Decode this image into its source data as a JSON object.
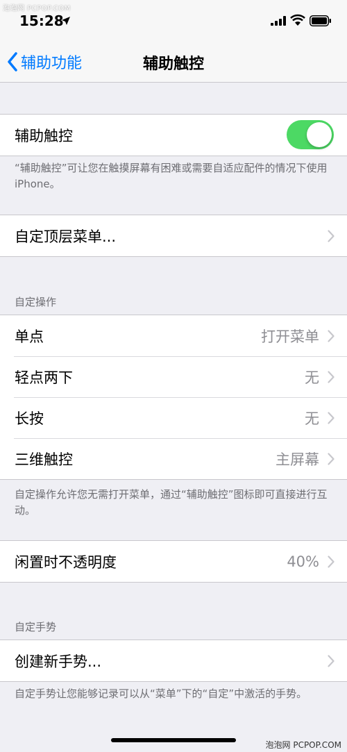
{
  "watermark_top": "泡泡网 PCPOP.COM",
  "watermark_bottom": "泡泡网 PCPOP.COM",
  "status": {
    "time": "15:28"
  },
  "nav": {
    "back_label": "辅助功能",
    "title": "辅助触控"
  },
  "assistive_touch": {
    "label": "辅助触控",
    "enabled": true,
    "footer": "“辅助触控”可让您在触摸屏幕有困难或需要自适应配件的情况下使用 iPhone。"
  },
  "custom_menu": {
    "label": "自定顶层菜单..."
  },
  "custom_actions": {
    "header": "自定操作",
    "rows": [
      {
        "label": "单点",
        "value": "打开菜单"
      },
      {
        "label": "轻点两下",
        "value": "无"
      },
      {
        "label": "长按",
        "value": "无"
      },
      {
        "label": "三维触控",
        "value": "主屏幕"
      }
    ],
    "footer": "自定操作允许您无需打开菜单，通过“辅助触控”图标即可直接进行互动。"
  },
  "idle_opacity": {
    "label": "闲置时不透明度",
    "value": "40%"
  },
  "custom_gestures": {
    "header": "自定手势",
    "create_label": "创建新手势...",
    "footer": "自定手势让您能够记录可以从“菜单”下的“自定”中激活的手势。"
  },
  "colors": {
    "accent": "#007aff",
    "toggle_on": "#4cd964",
    "background": "#efeff4"
  },
  "icons": [
    "location-arrow-icon",
    "signal-icon",
    "wifi-icon",
    "battery-icon",
    "chevron-left-icon",
    "chevron-right-icon"
  ]
}
